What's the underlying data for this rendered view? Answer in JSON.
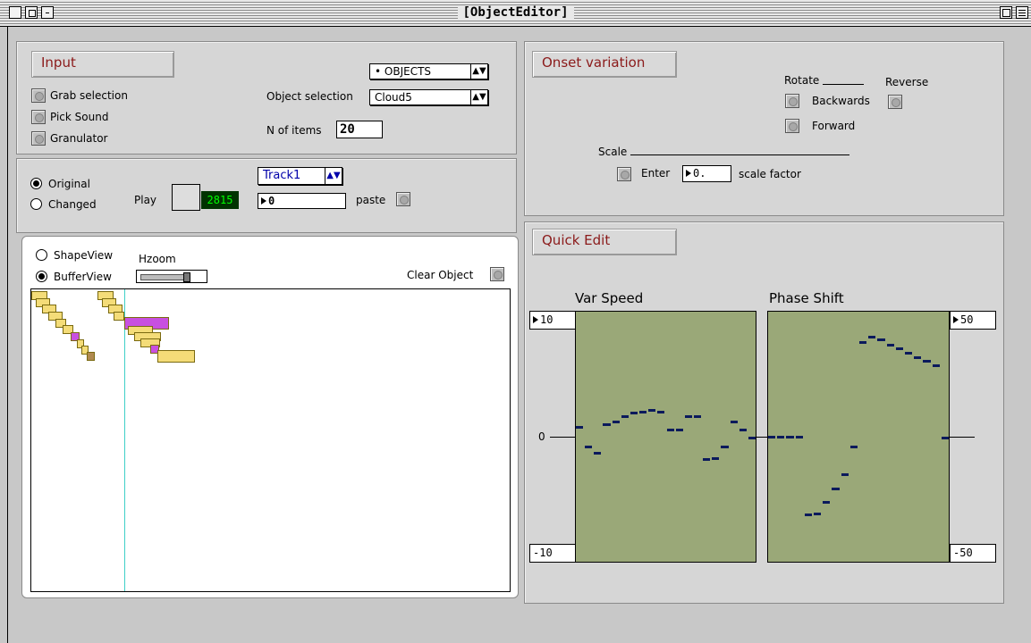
{
  "window": {
    "title": "[ObjectEditor]"
  },
  "input": {
    "title": "Input",
    "buttons": [
      "Grab selection",
      "Pick Sound",
      "Granulator"
    ],
    "mode_menu": "• OBJECTS",
    "object_selection_label": "Object selection",
    "object_selection_value": "Cloud5",
    "n_items_label": "N of items",
    "n_items_value": "20"
  },
  "transport": {
    "original_label": "Original",
    "changed_label": "Changed",
    "play_label": "Play",
    "counter": "2815",
    "track_menu": "Track1",
    "track_value": "0",
    "paste_label": "paste"
  },
  "view": {
    "shapeview_label": "ShapeView",
    "bufferview_label": "BufferView",
    "hzoom_label": "Hzoom",
    "clear_object_label": "Clear Object"
  },
  "onset": {
    "title": "Onset variation",
    "rotate_label": "Rotate",
    "reverse_label": "Reverse",
    "backwards_label": "Backwards",
    "forward_label": "Forward",
    "scale_label": "Scale",
    "enter_label": "Enter",
    "scale_value": "0.",
    "scale_factor_label": "scale factor"
  },
  "quick_edit": {
    "title": "Quick Edit",
    "var_speed_label": "Var Speed",
    "phase_shift_label": "Phase Shift",
    "var_max": "10",
    "var_zero": "0",
    "var_min": "-10",
    "phase_max": "50",
    "phase_min": "-50"
  },
  "colors": {
    "graph_bg": "#9aa878",
    "segment": "#0b1a5c",
    "counter_text": "#00ff00",
    "title_red": "#8b1a1a",
    "block_yellow": "#f4dc78",
    "block_magenta": "#c850e0"
  },
  "chart_data": [
    {
      "type": "scatter",
      "title": "Var Speed",
      "ylim": [
        -10,
        10
      ],
      "values": [
        0.8,
        -0.8,
        -1.3,
        1.0,
        1.2,
        1.6,
        1.9,
        2.0,
        2.1,
        2.0,
        0.6,
        0.6,
        1.6,
        1.6,
        -1.8,
        -1.7,
        -0.8,
        1.2,
        0.6,
        -0.1
      ]
    },
    {
      "type": "scatter",
      "title": "Phase Shift",
      "ylim": [
        -50,
        50
      ],
      "values": [
        -0.1,
        -0.1,
        -0.1,
        -0.1,
        -31.0,
        -30.5,
        -26.0,
        -20.5,
        -15.0,
        -4.0,
        37.5,
        39.7,
        38.5,
        36.5,
        35.0,
        33.5,
        31.5,
        30.0,
        28.5,
        -0.3
      ]
    }
  ]
}
